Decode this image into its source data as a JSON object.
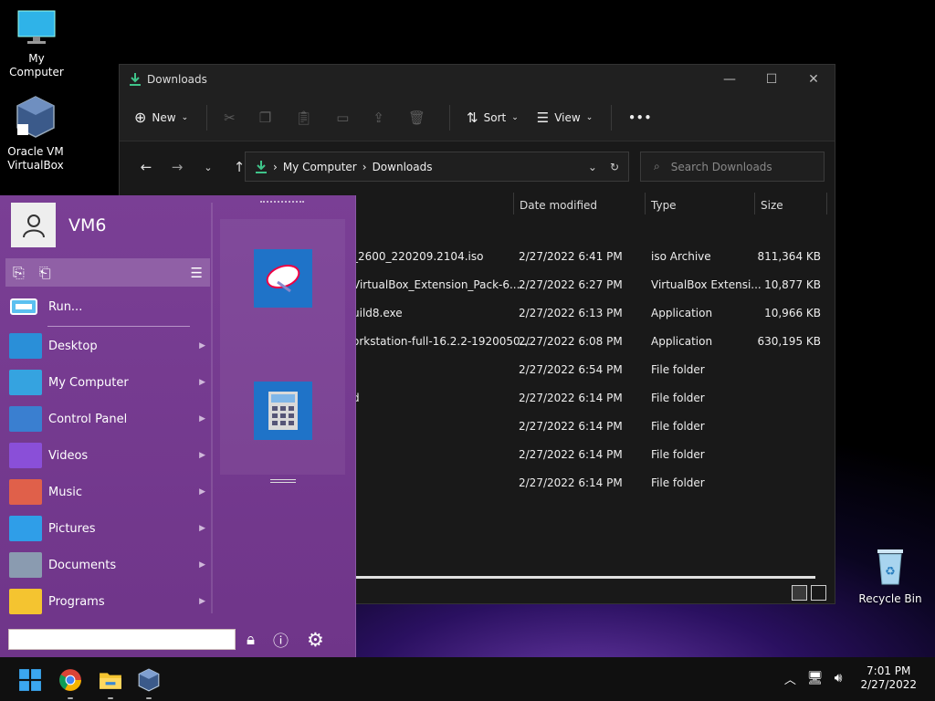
{
  "desktop": {
    "icons": [
      {
        "label": "My Computer",
        "icon": "monitor-icon"
      },
      {
        "label": "Oracle VM VirtualBox",
        "icon": "virtualbox-icon"
      },
      {
        "label": "Recycle Bin",
        "icon": "recycle-bin-icon"
      }
    ]
  },
  "explorer": {
    "title": "Downloads",
    "toolbar": {
      "new_label": "New",
      "sort_label": "Sort",
      "view_label": "View",
      "more_label": "•••"
    },
    "breadcrumb": [
      "My Computer",
      "Downloads"
    ],
    "search_placeholder": "Search Downloads",
    "columns": {
      "date": "Date modified",
      "type": "Type",
      "size": "Size"
    },
    "rows": [
      {
        "name": "_2600_220209.2104.iso",
        "date": "2/27/2022 6:41 PM",
        "type": "iso Archive",
        "size": "811,364 KB"
      },
      {
        "name": "VirtualBox_Extension_Pack-6....",
        "date": "2/27/2022 6:27 PM",
        "type": "VirtualBox Extensi...",
        "size": "10,877 KB"
      },
      {
        "name": "uild8.exe",
        "date": "2/27/2022 6:13 PM",
        "type": "Application",
        "size": "10,966 KB"
      },
      {
        "name": "orkstation-full-16.2.2-1920050...",
        "date": "2/27/2022 6:08 PM",
        "type": "Application",
        "size": "630,195 KB"
      },
      {
        "name": "",
        "date": "2/27/2022 6:54 PM",
        "type": "File folder",
        "size": ""
      },
      {
        "name": "d",
        "date": "2/27/2022 6:14 PM",
        "type": "File folder",
        "size": ""
      },
      {
        "name": "",
        "date": "2/27/2022 6:14 PM",
        "type": "File folder",
        "size": ""
      },
      {
        "name": "",
        "date": "2/27/2022 6:14 PM",
        "type": "File folder",
        "size": ""
      },
      {
        "name": "",
        "date": "2/27/2022 6:14 PM",
        "type": "File folder",
        "size": ""
      }
    ]
  },
  "startmenu": {
    "user": "VM6",
    "run_label": "Run...",
    "items": [
      {
        "label": "Desktop",
        "color": "#2a8fd8"
      },
      {
        "label": "My Computer",
        "color": "#35a3e0"
      },
      {
        "label": "Control Panel",
        "color": "#3a7fd0"
      },
      {
        "label": "Videos",
        "color": "#8a4fd8"
      },
      {
        "label": "Music",
        "color": "#e0604a"
      },
      {
        "label": "Pictures",
        "color": "#2f9ee8"
      },
      {
        "label": "Documents",
        "color": "#8a9bb0"
      },
      {
        "label": "Programs",
        "color": "#f4c430"
      }
    ]
  },
  "taskbar": {
    "time": "7:01 PM",
    "date": "2/27/2022"
  }
}
